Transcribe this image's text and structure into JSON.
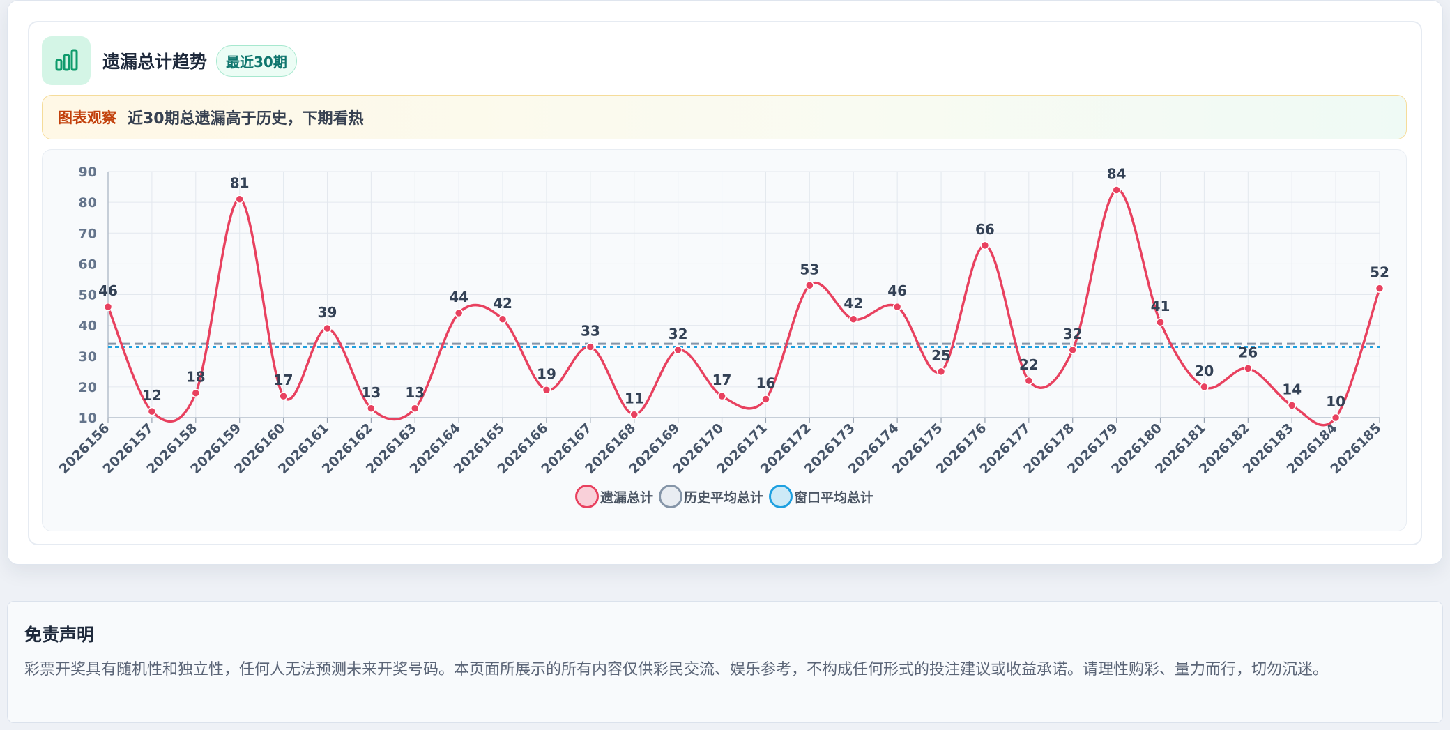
{
  "header": {
    "title": "遗漏总计趋势",
    "badge": "最近30期"
  },
  "observation": {
    "label": "图表观察",
    "text": "近30期总遗漏高于历史，下期看热"
  },
  "colors": {
    "series": "#e8415f",
    "historical": "#8595a8",
    "window": "#1ea0e0"
  },
  "chart_data": {
    "type": "line",
    "categories": [
      "2026156",
      "2026157",
      "2026158",
      "2026159",
      "2026160",
      "2026161",
      "2026162",
      "2026163",
      "2026164",
      "2026165",
      "2026166",
      "2026167",
      "2026168",
      "2026169",
      "2026170",
      "2026171",
      "2026172",
      "2026173",
      "2026174",
      "2026175",
      "2026176",
      "2026177",
      "2026178",
      "2026179",
      "2026180",
      "2026181",
      "2026182",
      "2026183",
      "2026184",
      "2026185"
    ],
    "series": [
      {
        "name": "遗漏总计",
        "values": [
          46,
          12,
          18,
          81,
          17,
          39,
          13,
          13,
          44,
          42,
          19,
          33,
          11,
          32,
          17,
          16,
          53,
          42,
          46,
          25,
          66,
          22,
          32,
          84,
          41,
          20,
          26,
          14,
          10,
          52
        ]
      }
    ],
    "reference_lines": [
      {
        "name": "历史平均总计",
        "value": 34,
        "style": "dashed"
      },
      {
        "name": "窗口平均总计",
        "value": 33,
        "style": "dotted"
      }
    ],
    "y_ticks": [
      10,
      20,
      30,
      40,
      50,
      60,
      70,
      80,
      90
    ],
    "ylim": [
      10,
      90
    ],
    "grid": true,
    "legend_position": "bottom",
    "legend": [
      "遗漏总计",
      "历史平均总计",
      "窗口平均总计"
    ]
  },
  "disclaimer": {
    "title": "免责声明",
    "body": "彩票开奖具有随机性和独立性，任何人无法预测未来开奖号码。本页面所展示的所有内容仅供彩民交流、娱乐参考，不构成任何形式的投注建议或收益承诺。请理性购彩、量力而行，切勿沉迷。"
  }
}
